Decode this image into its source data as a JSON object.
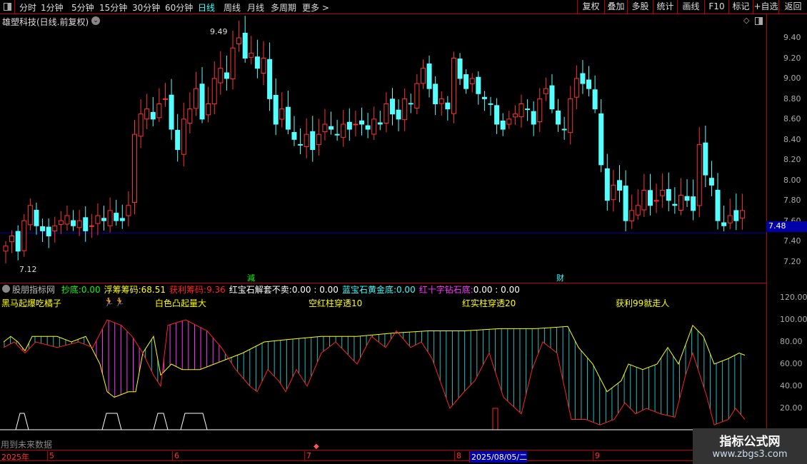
{
  "toolbar": {
    "periods": [
      "分时",
      "1分钟",
      "5分钟",
      "15分钟",
      "30分钟",
      "60分钟",
      "日线",
      "周线",
      "月线",
      "多周期",
      "更多 >"
    ],
    "active": "日线",
    "right_buttons": [
      "复权",
      "叠加",
      "多股",
      "统计",
      "画线",
      "F10",
      "标记",
      "+自选",
      "返回"
    ]
  },
  "title": "雄塑科技(日线.前复权)",
  "price_axis": [
    "9.40",
    "9.20",
    "9.00",
    "8.80",
    "8.60",
    "8.40",
    "8.20",
    "8.00",
    "7.80",
    "7.60",
    "7.40",
    "7.20"
  ],
  "current_price": "7.48",
  "high_label": "9.49",
  "low_label": "7.12",
  "markers": [
    "減",
    "财"
  ],
  "closes": [
    7.35,
    7.45,
    7.3,
    7.6,
    7.75,
    7.55,
    7.5,
    7.45,
    7.55,
    7.6,
    7.65,
    7.55,
    7.6,
    7.5,
    7.55,
    7.65,
    7.6,
    7.7,
    7.6,
    7.6,
    7.75,
    8.45,
    8.65,
    8.7,
    8.6,
    8.75,
    8.8,
    8.5,
    8.3,
    8.6,
    8.7,
    8.9,
    8.6,
    8.75,
    9.0,
    9.1,
    9.0,
    9.3,
    9.4,
    9.2,
    9.25,
    9.1,
    9.2,
    8.8,
    8.55,
    8.7,
    8.5,
    8.4,
    8.35,
    8.45,
    8.3,
    8.45,
    8.55,
    8.5,
    8.45,
    8.55,
    8.5,
    8.55,
    8.55,
    8.5,
    8.6,
    8.55,
    8.75,
    8.65,
    8.6,
    8.8,
    8.75,
    8.95,
    9.1,
    8.9,
    8.75,
    8.8,
    8.7,
    9.2,
    9.0,
    8.9,
    9.0,
    8.85,
    8.8,
    8.75,
    8.55,
    8.5,
    8.6,
    8.65,
    8.75,
    8.7,
    8.55,
    8.8,
    8.9,
    8.7,
    8.55,
    8.5,
    8.8,
    9.0,
    8.95,
    8.9,
    8.7,
    8.15,
    7.8,
    7.95,
    7.9,
    7.6,
    7.7,
    7.75,
    7.9,
    7.75,
    7.8,
    7.9,
    7.8,
    7.75,
    7.85,
    7.8,
    7.7,
    8.35,
    8.05,
    7.95,
    7.6,
    7.55,
    7.65,
    7.6,
    7.7
  ],
  "indicator": {
    "name": "股朋指标网",
    "values": [
      {
        "label": "抄底:",
        "value": "0.00",
        "color": "#0f0"
      },
      {
        "label": "浮筹筹码:",
        "value": "68.51",
        "color": "#ff0"
      },
      {
        "label": "获利筹码:",
        "value": "9.36",
        "color": "#f22"
      },
      {
        "label": "红宝石解套不卖:",
        "value": "0.00 : 0.00",
        "color": "#fff"
      },
      {
        "label": "蓝宝石黄金底:",
        "value": "0.00",
        "color": "#3ff"
      },
      {
        "label": "红十字钻石底:",
        "value": "0.00 : 0.00",
        "color": "#f3f"
      }
    ],
    "labels": [
      "黑马起爆吃橘子",
      "白色凸起量大",
      "空红柱穿透10",
      "红实柱穿透20",
      "获利99就走人"
    ],
    "axis": [
      "120.00",
      "100.00",
      "80.00",
      "60.00",
      "40.00",
      "20.00"
    ],
    "yellow": [
      [
        5,
        80
      ],
      [
        15,
        85
      ],
      [
        25,
        80
      ],
      [
        35,
        72
      ],
      [
        45,
        85
      ],
      [
        80,
        85
      ],
      [
        100,
        80
      ],
      [
        120,
        85
      ],
      [
        140,
        60
      ],
      [
        150,
        35
      ],
      [
        160,
        30
      ],
      [
        180,
        35
      ],
      [
        190,
        35
      ],
      [
        200,
        70
      ],
      [
        215,
        85
      ],
      [
        225,
        50
      ],
      [
        240,
        60
      ],
      [
        255,
        55
      ],
      [
        280,
        55
      ],
      [
        300,
        60
      ],
      [
        320,
        65
      ],
      [
        340,
        70
      ],
      [
        370,
        80
      ],
      [
        400,
        82
      ],
      [
        450,
        85
      ],
      [
        500,
        85
      ],
      [
        550,
        88
      ],
      [
        600,
        90
      ],
      [
        650,
        90
      ],
      [
        700,
        92
      ],
      [
        750,
        92
      ],
      [
        795,
        94
      ],
      [
        810,
        75
      ],
      [
        830,
        60
      ],
      [
        850,
        35
      ],
      [
        870,
        45
      ],
      [
        880,
        60
      ],
      [
        900,
        55
      ],
      [
        920,
        60
      ],
      [
        935,
        75
      ],
      [
        950,
        60
      ],
      [
        970,
        95
      ],
      [
        985,
        85
      ],
      [
        1000,
        60
      ],
      [
        1020,
        65
      ],
      [
        1035,
        70
      ],
      [
        1043,
        68
      ]
    ],
    "red": [
      [
        5,
        75
      ],
      [
        20,
        80
      ],
      [
        35,
        70
      ],
      [
        50,
        80
      ],
      [
        80,
        75
      ],
      [
        110,
        80
      ],
      [
        130,
        75
      ],
      [
        150,
        100
      ],
      [
        170,
        95
      ],
      [
        185,
        85
      ],
      [
        200,
        70
      ],
      [
        215,
        50
      ],
      [
        225,
        40
      ],
      [
        235,
        95
      ],
      [
        260,
        100
      ],
      [
        290,
        90
      ],
      [
        310,
        75
      ],
      [
        330,
        55
      ],
      [
        350,
        40
      ],
      [
        360,
        35
      ],
      [
        375,
        55
      ],
      [
        390,
        45
      ],
      [
        400,
        35
      ],
      [
        415,
        55
      ],
      [
        430,
        40
      ],
      [
        450,
        70
      ],
      [
        470,
        80
      ],
      [
        500,
        60
      ],
      [
        520,
        85
      ],
      [
        540,
        75
      ],
      [
        555,
        90
      ],
      [
        575,
        75
      ],
      [
        590,
        80
      ],
      [
        605,
        65
      ],
      [
        630,
        20
      ],
      [
        650,
        35
      ],
      [
        665,
        45
      ],
      [
        685,
        70
      ],
      [
        705,
        30
      ],
      [
        730,
        15
      ],
      [
        745,
        55
      ],
      [
        760,
        80
      ],
      [
        780,
        70
      ],
      [
        800,
        10
      ],
      [
        820,
        10
      ],
      [
        840,
        5
      ],
      [
        860,
        10
      ],
      [
        875,
        25
      ],
      [
        890,
        15
      ],
      [
        905,
        20
      ],
      [
        925,
        15
      ],
      [
        945,
        12
      ],
      [
        960,
        50
      ],
      [
        970,
        70
      ],
      [
        990,
        30
      ],
      [
        1000,
        5
      ],
      [
        1020,
        10
      ],
      [
        1030,
        20
      ],
      [
        1043,
        10
      ]
    ]
  },
  "future_note": "用到未来数据",
  "dates": [
    "2025年",
    "5",
    "6",
    "7",
    "8",
    "2025/08/05/二",
    "9"
  ],
  "watermark": {
    "title": "指标公式网",
    "url": "www.zbgs3.com"
  }
}
